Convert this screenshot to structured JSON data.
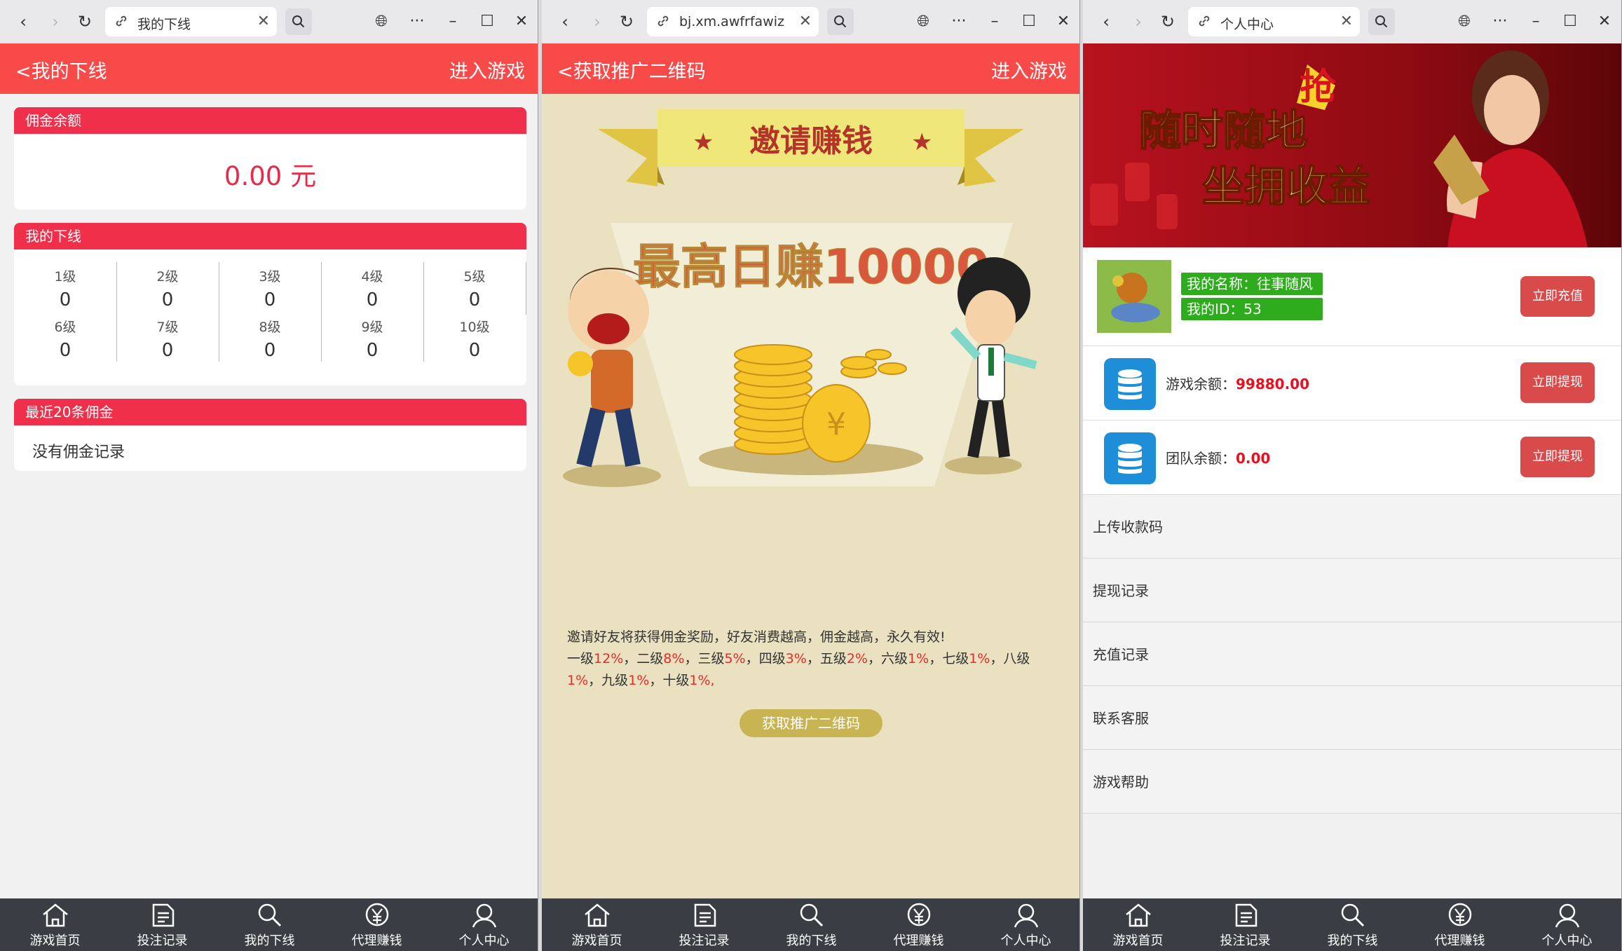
{
  "browser": {
    "tabs": [
      {
        "title": "我的下线"
      },
      {
        "title": "bj.xm.awfrfawizyc"
      },
      {
        "title": "个人中心"
      }
    ]
  },
  "win1": {
    "header_left": "<我的下线",
    "header_right": "进入游戏",
    "commission_title": "佣金余额",
    "commission_value": "0.00 元",
    "downline_title": "我的下线",
    "levels": [
      {
        "label": "1级",
        "value": "0"
      },
      {
        "label": "2级",
        "value": "0"
      },
      {
        "label": "3级",
        "value": "0"
      },
      {
        "label": "4级",
        "value": "0"
      },
      {
        "label": "5级",
        "value": "0"
      },
      {
        "label": "6级",
        "value": "0"
      },
      {
        "label": "7级",
        "value": "0"
      },
      {
        "label": "8级",
        "value": "0"
      },
      {
        "label": "9级",
        "value": "0"
      },
      {
        "label": "10级",
        "value": "0"
      }
    ],
    "recent_title": "最近20条佣金",
    "recent_empty": "没有佣金记录"
  },
  "win2": {
    "header_left": "<获取推广二维码",
    "header_right": "进入游戏",
    "ribbon_text": "邀请赚钱",
    "headline": "最高日赚10000",
    "line1": "邀请好友将获得佣金奖励，好友消费越高，佣金越高，永久有效!",
    "rates": [
      {
        "level": "一级",
        "rate": "12%"
      },
      {
        "level": "二级",
        "rate": "8%"
      },
      {
        "level": "三级",
        "rate": "5%"
      },
      {
        "level": "四级",
        "rate": "3%"
      },
      {
        "level": "五级",
        "rate": "2%"
      },
      {
        "level": "六级",
        "rate": "1%"
      },
      {
        "level": "七级",
        "rate": "1%"
      },
      {
        "level": "八级",
        "rate": "1%"
      },
      {
        "level": "九级",
        "rate": "1%"
      },
      {
        "level": "十级",
        "rate": "1%"
      }
    ],
    "qr_button": "获取推广二维码"
  },
  "win3": {
    "banner_line1": "随时随地",
    "banner_line2": "坐拥收益",
    "banner_badge": "抢",
    "name": "我的名称：往事随风",
    "id": "我的ID：53",
    "recharge_button": "立即充值",
    "game_balance_label": "游戏余额：",
    "game_balance_value": "99880.00",
    "team_balance_label": "团队余额：",
    "team_balance_value": "0.00",
    "withdraw_button": "立即提现",
    "menu": [
      "上传收款码",
      "提现记录",
      "充值记录",
      "联系客服",
      "游戏帮助"
    ]
  },
  "bottom_nav": [
    "游戏首页",
    "投注记录",
    "我的下线",
    "代理赚钱",
    "个人中心"
  ],
  "colors": {
    "header_red": "#f94a4a",
    "section_red": "#f0304a",
    "green": "#2eac1e",
    "nav_bg": "#3a3e44",
    "accent_blue": "#1e8ed8"
  }
}
